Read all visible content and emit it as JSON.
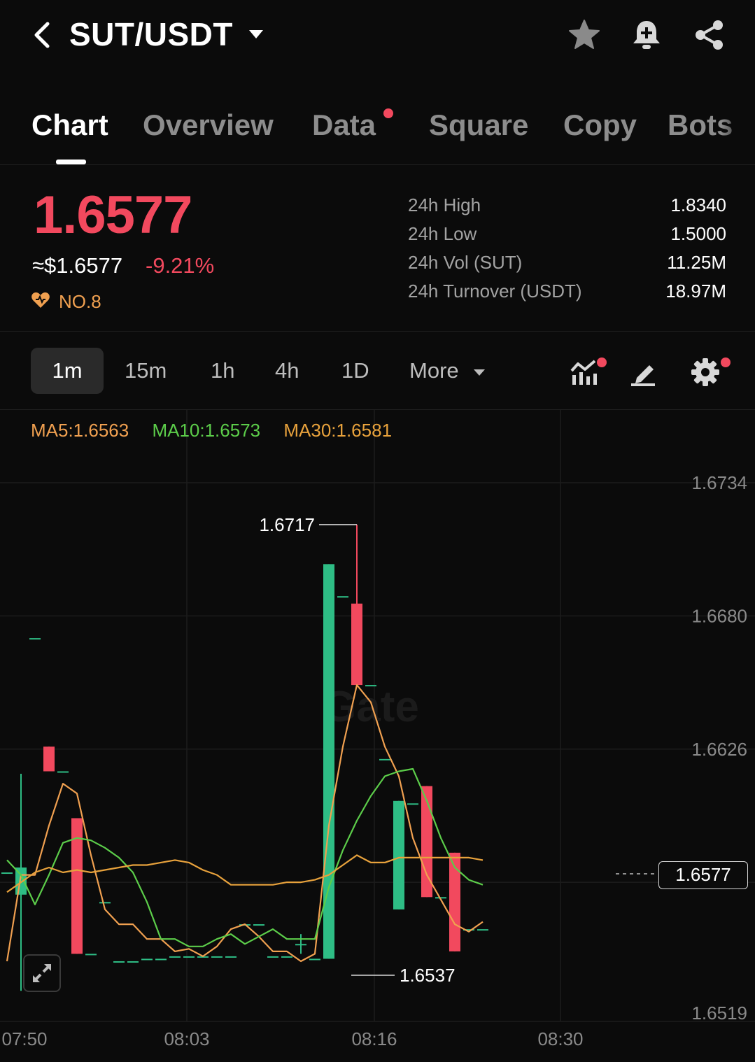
{
  "header": {
    "pair": "SUT/USDT",
    "icons": [
      "chevron-left-icon",
      "caret-down-icon",
      "star-icon",
      "bell-plus-icon",
      "share-icon"
    ]
  },
  "tabs": [
    {
      "label": "Chart",
      "active": true
    },
    {
      "label": "Overview"
    },
    {
      "label": "Data",
      "badge": true
    },
    {
      "label": "Square"
    },
    {
      "label": "Copy"
    },
    {
      "label": "Bots"
    }
  ],
  "ticker": {
    "last_price": "1.6577",
    "usd_price": "≈$1.6577",
    "change": "-9.21%",
    "rank": "NO.8",
    "stats": [
      {
        "label": "24h High",
        "value": "1.8340"
      },
      {
        "label": "24h Low",
        "value": "1.5000"
      },
      {
        "label": "24h Vol (SUT)",
        "value": "11.25M"
      },
      {
        "label": "24h Turnover (USDT)",
        "value": "18.97M"
      }
    ]
  },
  "timeframes": {
    "items": [
      "1m",
      "15m",
      "1h",
      "4h",
      "1D"
    ],
    "active": "1m",
    "more_label": "More"
  },
  "indicators": {
    "ma5": "MA5:1.6563",
    "ma10": "MA10:1.6573",
    "ma30": "MA30:1.6581"
  },
  "colors": {
    "up": "#2ebd85",
    "down": "#f2495e",
    "ma5": "#f0a050",
    "ma10": "#5ccd4a",
    "ma30": "#e8a23c"
  },
  "chart_data": {
    "type": "candlestick",
    "watermark": "Gate",
    "y_ticks": [
      "1.6734",
      "1.6680",
      "1.6626",
      "1.6519"
    ],
    "x_ticks": [
      "07:50",
      "08:03",
      "08:16",
      "08:30"
    ],
    "ylim": [
      1.6519,
      1.6734
    ],
    "high_label": "1.6717",
    "low_label": "1.6537",
    "current_price": "1.6577",
    "candles": [
      {
        "o": 1.6576,
        "h": 1.6576,
        "l": 1.6576,
        "c": 1.6576
      },
      {
        "o": 1.6567,
        "h": 1.6616,
        "l": 1.6528,
        "c": 1.6578
      },
      {
        "o": 1.6671,
        "h": 1.6671,
        "l": 1.6671,
        "c": 1.6671
      },
      {
        "o": 1.6627,
        "h": 1.6627,
        "l": 1.6617,
        "c": 1.6617
      },
      {
        "o": 1.6617,
        "h": 1.6617,
        "l": 1.6617,
        "c": 1.6617
      },
      {
        "o": 1.6598,
        "h": 1.6598,
        "l": 1.6543,
        "c": 1.6543
      },
      {
        "o": 1.6543,
        "h": 1.6543,
        "l": 1.6543,
        "c": 1.6543
      },
      {
        "o": 1.6564,
        "h": 1.6564,
        "l": 1.6564,
        "c": 1.6564
      },
      {
        "o": 1.654,
        "h": 1.654,
        "l": 1.654,
        "c": 1.654
      },
      {
        "o": 1.654,
        "h": 1.654,
        "l": 1.654,
        "c": 1.654
      },
      {
        "o": 1.6541,
        "h": 1.6541,
        "l": 1.6541,
        "c": 1.6541
      },
      {
        "o": 1.6541,
        "h": 1.6541,
        "l": 1.6541,
        "c": 1.6541
      },
      {
        "o": 1.6542,
        "h": 1.6542,
        "l": 1.6542,
        "c": 1.6542
      },
      {
        "o": 1.6542,
        "h": 1.6542,
        "l": 1.6542,
        "c": 1.6542
      },
      {
        "o": 1.6542,
        "h": 1.6542,
        "l": 1.6542,
        "c": 1.6542
      },
      {
        "o": 1.6542,
        "h": 1.6542,
        "l": 1.6542,
        "c": 1.6542
      },
      {
        "o": 1.6542,
        "h": 1.6542,
        "l": 1.6542,
        "c": 1.6542
      },
      {
        "o": 1.6555,
        "h": 1.6555,
        "l": 1.6555,
        "c": 1.6555
      },
      {
        "o": 1.6555,
        "h": 1.6555,
        "l": 1.6555,
        "c": 1.6555
      },
      {
        "o": 1.6542,
        "h": 1.6542,
        "l": 1.6542,
        "c": 1.6542
      },
      {
        "o": 1.6542,
        "h": 1.6542,
        "l": 1.6542,
        "c": 1.6542
      },
      {
        "o": 1.6547,
        "h": 1.6551,
        "l": 1.6543,
        "c": 1.6547
      },
      {
        "o": 1.6541,
        "h": 1.6541,
        "l": 1.6541,
        "c": 1.6541
      },
      {
        "o": 1.6541,
        "h": 1.6701,
        "l": 1.6541,
        "c": 1.6701
      },
      {
        "o": 1.6688,
        "h": 1.6688,
        "l": 1.6688,
        "c": 1.6688
      },
      {
        "o": 1.6685,
        "h": 1.6717,
        "l": 1.6652,
        "c": 1.6652
      },
      {
        "o": 1.6652,
        "h": 1.6652,
        "l": 1.6652,
        "c": 1.6652
      },
      {
        "o": 1.6622,
        "h": 1.6622,
        "l": 1.6622,
        "c": 1.6622
      },
      {
        "o": 1.6561,
        "h": 1.6605,
        "l": 1.6561,
        "c": 1.6605
      },
      {
        "o": 1.6604,
        "h": 1.6604,
        "l": 1.6604,
        "c": 1.6604
      },
      {
        "o": 1.6611,
        "h": 1.6611,
        "l": 1.6566,
        "c": 1.6566
      },
      {
        "o": 1.6566,
        "h": 1.6566,
        "l": 1.6566,
        "c": 1.6566
      },
      {
        "o": 1.6584,
        "h": 1.6584,
        "l": 1.6544,
        "c": 1.6544
      },
      {
        "o": 1.6553,
        "h": 1.6553,
        "l": 1.6553,
        "c": 1.6553
      },
      {
        "o": 1.6553,
        "h": 1.6553,
        "l": 1.6553,
        "c": 1.6553
      }
    ],
    "series": [
      {
        "name": "MA5",
        "values": [
          1.654,
          1.6575,
          1.6575,
          1.6595,
          1.6612,
          1.6608,
          1.6583,
          1.6561,
          1.6555,
          1.6555,
          1.6549,
          1.6549,
          1.6544,
          1.6545,
          1.6542,
          1.6546,
          1.6553,
          1.6555,
          1.655,
          1.6544,
          1.6544,
          1.654,
          1.6543,
          1.6595,
          1.6627,
          1.6652,
          1.6645,
          1.6627,
          1.6615,
          1.659,
          1.6575,
          1.6565,
          1.6555,
          1.6552,
          1.6556
        ]
      },
      {
        "name": "MA10",
        "values": [
          1.6581,
          1.6575,
          1.6563,
          1.6575,
          1.6588,
          1.659,
          1.6589,
          1.6586,
          1.6582,
          1.6576,
          1.6564,
          1.6549,
          1.6549,
          1.6546,
          1.6546,
          1.6549,
          1.6551,
          1.6547,
          1.655,
          1.6553,
          1.6549,
          1.6549,
          1.6549,
          1.657,
          1.6585,
          1.6597,
          1.6607,
          1.6615,
          1.6617,
          1.6618,
          1.6605,
          1.659,
          1.6578,
          1.6573,
          1.6571
        ]
      },
      {
        "name": "MA30",
        "values": [
          1.6568,
          1.6572,
          1.6576,
          1.6578,
          1.6576,
          1.6577,
          1.6576,
          1.6577,
          1.6578,
          1.6579,
          1.6579,
          1.658,
          1.6581,
          1.658,
          1.6577,
          1.6575,
          1.6571,
          1.6571,
          1.6571,
          1.6571,
          1.6572,
          1.6572,
          1.6573,
          1.6575,
          1.6579,
          1.6583,
          1.658,
          1.658,
          1.6582,
          1.6582,
          1.6582,
          1.6582,
          1.6582,
          1.6582,
          1.6581
        ]
      }
    ]
  }
}
